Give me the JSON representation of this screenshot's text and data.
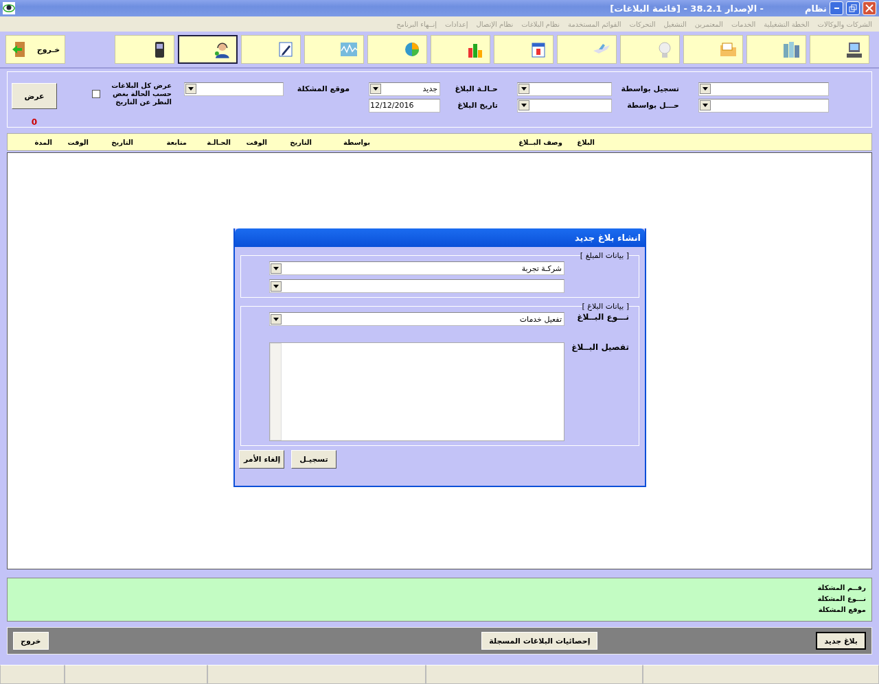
{
  "window": {
    "title_prefix": "نظام",
    "title": "- الإصدار 38.2.1 - [قائمة البلاغات]"
  },
  "menu": [
    "الشركات والوكالات",
    "الخطة التشغيلية",
    "الخدمات",
    "المعتمرين",
    "التشغيل",
    "التحركات",
    "القوائم المستخدمة",
    "نظام البلاغات",
    "نظام الإتصال",
    "إعدادات",
    "إنــهاء البرنامج"
  ],
  "toolbar": {
    "buttons": [
      {
        "kind": "computer",
        "selected": false
      },
      {
        "kind": "buildings",
        "selected": false
      },
      {
        "kind": "folder",
        "selected": false
      },
      {
        "kind": "bulb",
        "selected": false
      },
      {
        "kind": "plane",
        "selected": false
      },
      {
        "kind": "calendar",
        "selected": false
      },
      {
        "kind": "bars",
        "selected": false
      },
      {
        "kind": "pie",
        "selected": false
      },
      {
        "kind": "wave",
        "selected": false
      },
      {
        "kind": "pencil",
        "selected": false
      },
      {
        "kind": "agent",
        "selected": true
      },
      {
        "kind": "phone",
        "selected": false
      }
    ],
    "exit_label": "خـروج"
  },
  "filters": {
    "columns": [
      [
        {
          "kind": "combo"
        },
        {
          "kind": "combo"
        }
      ],
      [
        {
          "kind": "combo",
          "label": "تسجيل بواسطة"
        },
        {
          "kind": "combo",
          "label": "حـــل بواسطة"
        }
      ],
      [
        {
          "kind": "combo",
          "label": "حـالـة البلاغ",
          "value": "جديد"
        },
        {
          "kind": "date",
          "label": "تاريخ البلاغ",
          "value": "12/12/2016"
        }
      ],
      [
        {
          "kind": "combo",
          "label": "موقع المشكلة"
        }
      ]
    ],
    "show_all": {
      "label": "عرض كل البلاغات حسب الحالة بغض النظر عن التاريخ",
      "checked": false
    },
    "show_button": "عرض",
    "count": "0"
  },
  "table": {
    "columns": [
      "البلاغ",
      "وصف البــلاغ",
      "بواسطة",
      "التاريخ",
      "الوقت",
      "الحـالـة",
      "متابعة",
      "التاريخ",
      "الوقت",
      "المدة"
    ]
  },
  "dialog": {
    "title": "انشاء بلاغ جديد",
    "groups": [
      {
        "title": "[ بيانات المبلغ ]",
        "fields": [
          {
            "kind": "combo",
            "value": "شركـة تجربة"
          },
          {
            "kind": "combo"
          }
        ]
      },
      {
        "title": "[ بيانات البلاغ ]",
        "fields": [
          {
            "kind": "combo",
            "label": "نـــوع البــلاغ",
            "value": "تفعيل خدمات"
          },
          {
            "kind": "memo",
            "label": "تفصيل البــلاغ"
          }
        ]
      }
    ],
    "buttons": [
      "تسجيـل",
      "إلغاء الأمر"
    ]
  },
  "details": [
    "رقــم المشكلة",
    "نـــوع المشكلة",
    "موقع المشكلة"
  ],
  "actions": {
    "new": "بلاغ جديد",
    "stats": "إحصائيات البلاغات المسجلة",
    "exit": "خروج"
  }
}
